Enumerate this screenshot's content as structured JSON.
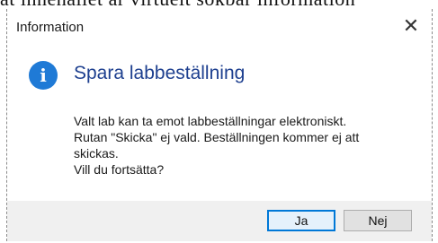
{
  "backdrop": {
    "text": "at innehållet är virtuelt sökbar information"
  },
  "dialog": {
    "title": "Information",
    "close_glyph": "✕",
    "icon": "info-icon",
    "icon_glyph": "i",
    "heading": "Spara labbeställning",
    "message_lines": [
      "Valt lab kan ta emot labbeställningar elektroniskt.",
      "Rutan \"Skicka\" ej vald. Beställningen kommer ej att",
      "skickas.",
      "Vill du fortsätta?"
    ],
    "buttons": {
      "yes": "Ja",
      "no": "Nej"
    }
  },
  "colors": {
    "accent": "#1f7ad6",
    "heading": "#1d3f8f",
    "focus_border": "#0078d7",
    "footer_bg": "#f0f0f0"
  }
}
